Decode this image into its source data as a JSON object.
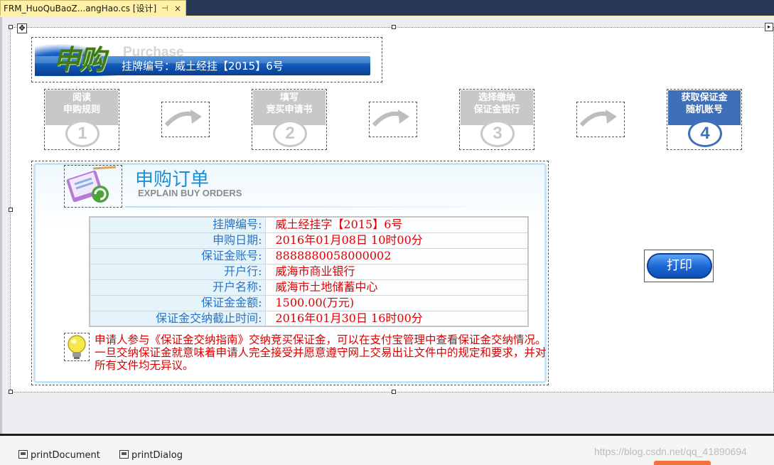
{
  "tab": {
    "title": "FRM_HuoQuBaoZ...angHao.cs [设计]",
    "pin": "⊣",
    "close": "×"
  },
  "banner": {
    "cn_logo": "申购",
    "en_logo": "Purchase",
    "listing_label": "挂牌编号：",
    "listing_value": "威土经挂【2015】6号"
  },
  "steps": [
    {
      "line1": "阅读",
      "line2": "申购规则",
      "num": "1",
      "active": false
    },
    {
      "line1": "填写",
      "line2": "竞买申请书",
      "num": "2",
      "active": false
    },
    {
      "line1": "选择缴纳",
      "line2": "保证金银行",
      "num": "3",
      "active": false
    },
    {
      "line1": "获取保证金",
      "line2": "随机账号",
      "num": "4",
      "active": true
    }
  ],
  "order": {
    "title": "申购订单",
    "subtitle": "EXPLAIN BUY ORDERS",
    "rows": [
      {
        "label": "挂牌编号:",
        "value": "威土经挂字【2015】6号"
      },
      {
        "label": "申购日期:",
        "value": "2016年01月08日 10时00分"
      },
      {
        "label": "保证金账号:",
        "value": "8888880058000002"
      },
      {
        "label": "开户行:",
        "value": "威海市商业银行"
      },
      {
        "label": "开户名称:",
        "value": "威海市土地储蓄中心"
      },
      {
        "label": "保证金金额:",
        "value": "1500.00(万元)"
      },
      {
        "label": "保证金交纳截止时间:",
        "value": "2016年01月30日 16时00分"
      }
    ],
    "notice": "申请人参与《保证金交纳指南》交纳竞买保证金，可以在支付宝管理中查看保证金交纳情况。一旦交纳保证金就意味着申请人完全接受并愿意遵守网上交易出让文件中的规定和要求，并对所有文件均无异议。"
  },
  "print_button": "打印",
  "tray": {
    "item1": "printDocument",
    "item2": "printDialog"
  },
  "watermark": "https://blog.csdn.net/qq_41890694",
  "colors": {
    "accent_blue": "#1a8fd6",
    "value_red": "#e00000",
    "step_active": "#3d70b9",
    "step_inactive": "#c8c8c8"
  }
}
